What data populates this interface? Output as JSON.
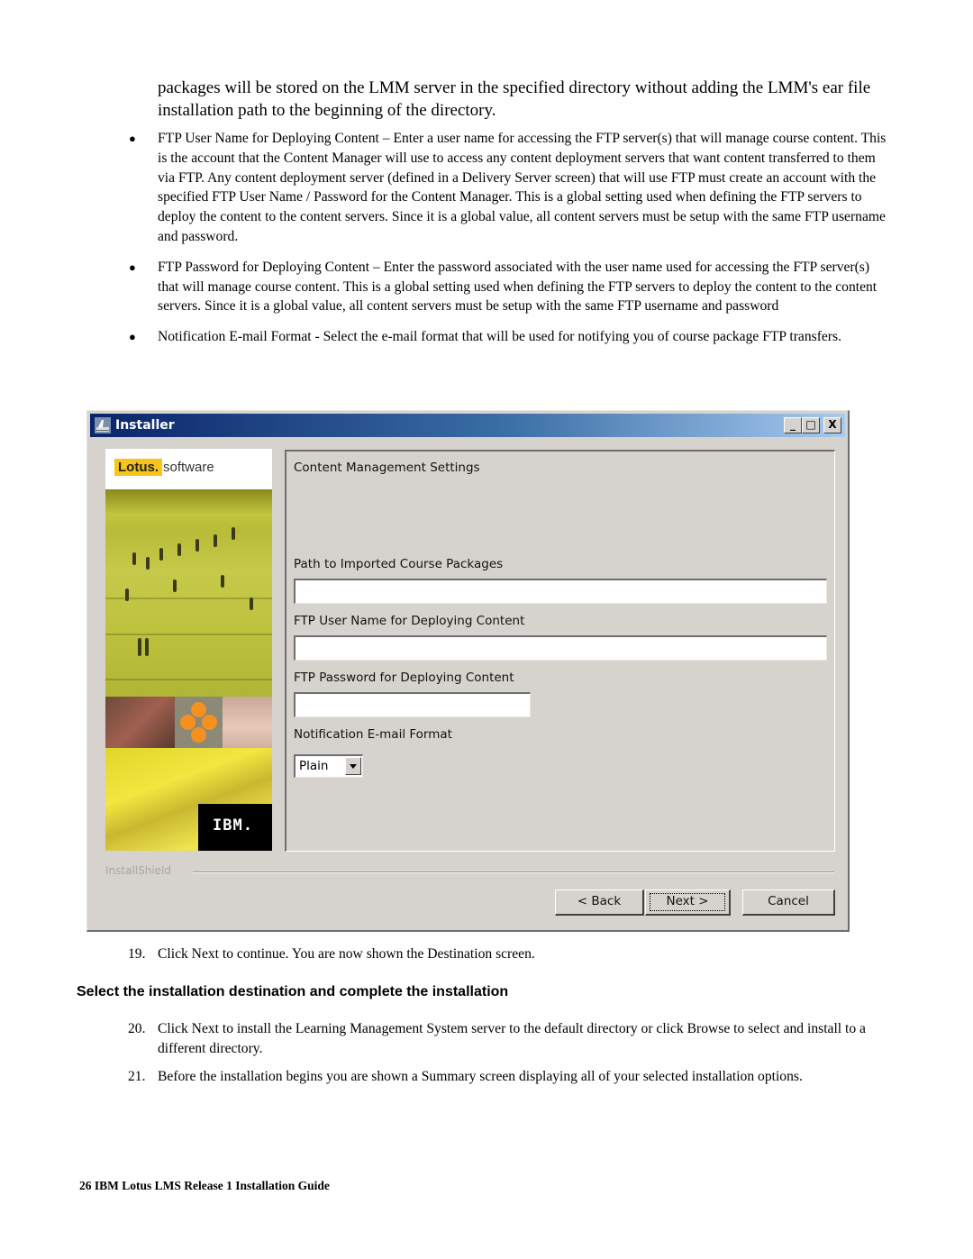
{
  "intro_text": "packages will be stored on the LMM server in the specified directory without adding the LMM's ear file installation path to the beginning of the directory.",
  "bullets": [
    "FTP User Name for Deploying Content – Enter a user name for accessing the FTP server(s) that will manage course content. This is the account that the Content Manager will use to access any content deployment servers that want content transferred to them via FTP. Any content deployment server (defined in a Delivery Server screen) that will use FTP must create an account with the specified FTP User Name / Password for the Content Manager. This is a global setting used when defining the FTP servers to deploy the content to the content servers. Since it is a global value, all content servers must be setup with the same FTP username and password.",
    "FTP Password for Deploying Content – Enter the password associated with the user name used for accessing the FTP server(s) that will manage course content. This is a global setting used when defining the FTP servers to deploy the content to the content servers. Since it is a global value, all content servers must be setup with the same FTP username and password",
    "Notification E-mail Format - Select the e-mail format that will be used for notifying you of course package FTP transfers."
  ],
  "installer": {
    "title": "Installer",
    "title_buttons": {
      "minimize": "_",
      "maximize": "□",
      "close": "X"
    },
    "brand": {
      "lotus": "Lotus.",
      "software": "software",
      "ibm": "IBM."
    },
    "panel_title": "Content Management Settings",
    "fields": {
      "path_label": "Path to Imported Course Packages",
      "path_value": "",
      "ftp_user_label": "FTP User Name for Deploying Content",
      "ftp_user_value": "",
      "ftp_password_label": "FTP Password for Deploying Content",
      "ftp_password_value": "",
      "email_format_label": "Notification E-mail Format",
      "email_format_selected": "Plain"
    },
    "installshield_label": "InstallShield",
    "buttons": {
      "back": "< Back",
      "next": "Next >",
      "cancel": "Cancel"
    }
  },
  "steps": [
    {
      "num": "19.",
      "text": "Click Next to continue. You are now shown the Destination screen."
    },
    {
      "num": "20.",
      "text": "Click Next to install the Learning Management System server to the default directory or click Browse to select and install to a different directory."
    },
    {
      "num": "21.",
      "text": "Before the installation begins you are shown a Summary screen displaying all of your selected installation options."
    }
  ],
  "section_heading": "Select the installation destination and complete the installation",
  "footer": "26 IBM Lotus LMS Release 1 Installation Guide"
}
